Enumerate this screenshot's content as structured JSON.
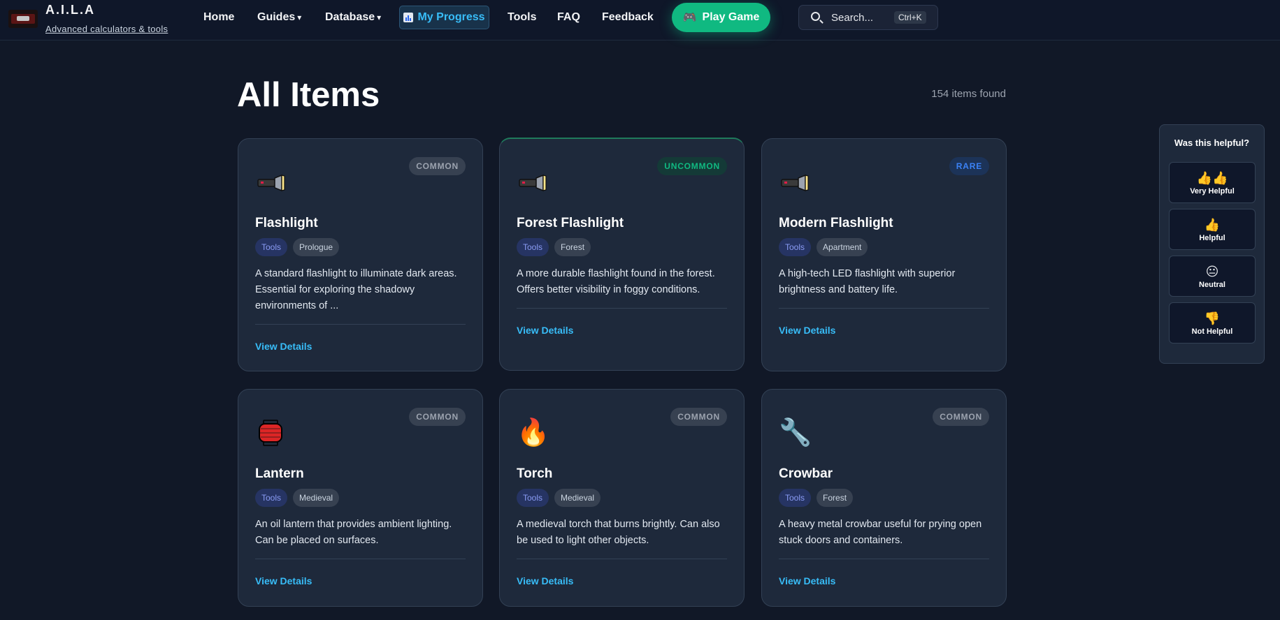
{
  "brand": {
    "title": "A.I.L.A",
    "subtitle": "Advanced calculators & tools"
  },
  "nav": {
    "home": "Home",
    "guides": "Guides",
    "database": "Database",
    "dropdown_caret": "▾",
    "my_progress": "My Progress",
    "tools": "Tools",
    "faq": "FAQ",
    "feedback": "Feedback",
    "play_game": "Play Game",
    "play_icon": "🎮"
  },
  "search": {
    "placeholder": "Search...",
    "shortcut": "Ctrl+K"
  },
  "page": {
    "title": "All Items",
    "count": "154 items found"
  },
  "view_details_label": "View Details",
  "items": [
    {
      "name": "Flashlight",
      "rarity": "COMMON",
      "category": "Tools",
      "location": "Prologue",
      "icon": "flashlight-icon",
      "description": "A standard flashlight to illuminate dark areas. Essential for exploring the shadowy environments of ..."
    },
    {
      "name": "Forest Flashlight",
      "rarity": "UNCOMMON",
      "category": "Tools",
      "location": "Forest",
      "icon": "flashlight-icon",
      "description": "A more durable flashlight found in the forest. Offers better visibility in foggy conditions."
    },
    {
      "name": "Modern Flashlight",
      "rarity": "RARE",
      "category": "Tools",
      "location": "Apartment",
      "icon": "flashlight-icon",
      "description": "A high-tech LED flashlight with superior brightness and battery life."
    },
    {
      "name": "Lantern",
      "rarity": "COMMON",
      "category": "Tools",
      "location": "Medieval",
      "icon": "lantern-icon",
      "description": "An oil lantern that provides ambient lighting. Can be placed on surfaces."
    },
    {
      "name": "Torch",
      "rarity": "COMMON",
      "category": "Tools",
      "location": "Medieval",
      "icon": "fire-icon",
      "emoji": "🔥",
      "description": "A medieval torch that burns brightly. Can also be used to light other objects."
    },
    {
      "name": "Crowbar",
      "rarity": "COMMON",
      "category": "Tools",
      "location": "Forest",
      "icon": "wrench-icon",
      "emoji": "🔧",
      "description": "A heavy metal crowbar useful for prying open stuck doors and containers."
    }
  ],
  "feedback_widget": {
    "question": "Was this helpful?",
    "options": [
      {
        "emoji": "👍👍",
        "label": "Very Helpful"
      },
      {
        "emoji": "👍",
        "label": "Helpful"
      },
      {
        "emoji": "😐",
        "label": "Neutral"
      },
      {
        "emoji": "👎",
        "label": "Not Helpful"
      }
    ]
  },
  "colors": {
    "background": "#111827",
    "card": "#1e293b",
    "accent": "#38bdf8",
    "play_button": "#10b981",
    "common": "#9ca3af",
    "uncommon": "#10b981",
    "rare": "#3b82f6"
  }
}
